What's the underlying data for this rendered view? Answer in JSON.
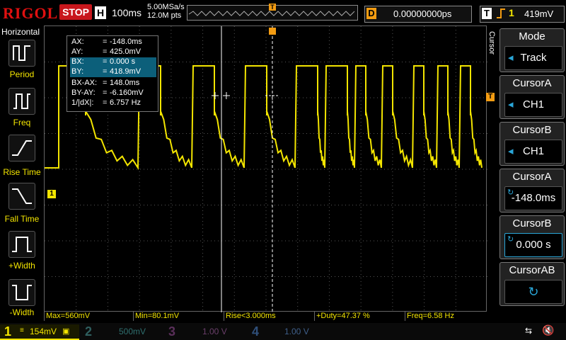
{
  "top": {
    "brand": "RIGOL",
    "run_state": "STOP",
    "h_label": "H",
    "timebase": "100ms",
    "sample_rate": "5.00MSa/s",
    "memory_depth": "12.0M pts",
    "trigger_marker": "T",
    "delay_label": "D",
    "delay_value": "0.00000000ps",
    "trig_label": "T",
    "trig_edge_icon": "rising-edge-icon",
    "trig_channel": "1",
    "trig_level": "419mV"
  },
  "left_panel": {
    "title": "Horizontal",
    "items": [
      {
        "label": "Period",
        "icon": "period-icon"
      },
      {
        "label": "Freq",
        "icon": "frequency-icon"
      },
      {
        "label": "Rise Time",
        "icon": "rise-time-icon"
      },
      {
        "label": "Fall Time",
        "icon": "fall-time-icon"
      },
      {
        "label": "+Width",
        "icon": "positive-width-icon"
      },
      {
        "label": "-Width",
        "icon": "negative-width-icon"
      }
    ]
  },
  "cursor_readout": {
    "rows": [
      {
        "k": "AX:",
        "v": "-148.0ms"
      },
      {
        "k": "AY:",
        "v": "425.0mV"
      },
      {
        "k": "BX:",
        "v": "0.000 s"
      },
      {
        "k": "BY:",
        "v": "418.9mV"
      },
      {
        "k": "BX-AX:",
        "v": "148.0ms"
      },
      {
        "k": "BY-AY:",
        "v": "-6.160mV"
      },
      {
        "k": "1/|dX|:",
        "v": "6.757 Hz"
      }
    ],
    "eq": "="
  },
  "right_menu": {
    "side_label": "Cursor",
    "items": [
      {
        "title": "Mode",
        "value": "Track"
      },
      {
        "title": "CursorA",
        "value": "CH1"
      },
      {
        "title": "CursorB",
        "value": "CH1"
      },
      {
        "title": "CursorA",
        "value": "-148.0ms"
      },
      {
        "title": "CursorB",
        "value": "0.000 s"
      },
      {
        "title": "CursorAB",
        "value": ""
      }
    ]
  },
  "measurements": [
    "Max=560mV",
    "Min=80.1mV",
    "Rise<3.000ms",
    "+Duty=47.37 %",
    "Freq=6.58 Hz"
  ],
  "channels": [
    {
      "num": "1",
      "value": "154mV",
      "color": "#f3e500"
    },
    {
      "num": "2",
      "value": "500mV",
      "color": "#00b3b3"
    },
    {
      "num": "3",
      "value": "1.00 V",
      "color": "#c040c0"
    },
    {
      "num": "4",
      "value": "1.00 V",
      "color": "#2a7fd5"
    }
  ],
  "channel1_marker": "1",
  "colors": {
    "ch1": "#f3e500",
    "accent": "#f39c12",
    "brand": "#e01010"
  }
}
